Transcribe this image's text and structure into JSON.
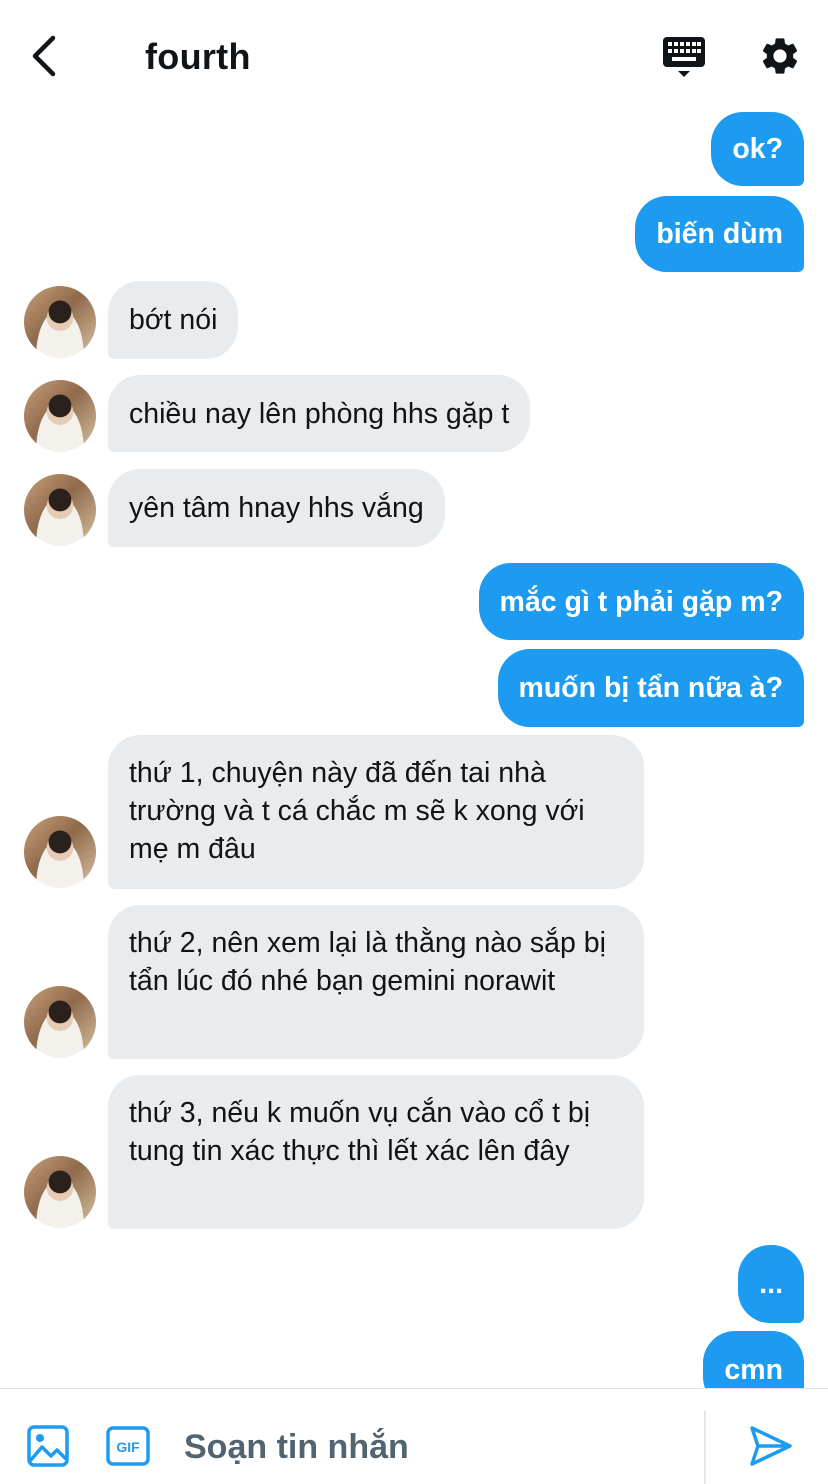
{
  "header": {
    "title": "fourth",
    "icons": {
      "back": "back-arrow-icon",
      "keyboard": "keyboard-icon",
      "settings": "gear-icon"
    }
  },
  "colors": {
    "accent": "#1d9bf0",
    "incoming_bubble": "#e8ecef",
    "text": "#0f1419",
    "muted": "#536471"
  },
  "messages": [
    {
      "dir": "out",
      "text": "ok?"
    },
    {
      "dir": "out",
      "text": "biến dùm"
    },
    {
      "dir": "in",
      "text": "bớt nói"
    },
    {
      "dir": "in",
      "text": "chiều nay lên phòng hhs gặp t"
    },
    {
      "dir": "in",
      "text": "yên tâm hnay hhs vắng"
    },
    {
      "dir": "out",
      "text": "mắc gì t phải gặp m?"
    },
    {
      "dir": "out",
      "text": "muốn bị tẩn nữa à?"
    },
    {
      "dir": "in",
      "text": "thứ 1, chuyện này đã đến tai nhà trường và t cá chắc m sẽ k xong với mẹ m đâu"
    },
    {
      "dir": "in",
      "text": "thứ 2, nên xem lại là thằng nào sắp bị tẩn lúc đó nhé bạn gemini norawit"
    },
    {
      "dir": "in",
      "text": "thứ 3, nếu k muốn vụ cắn vào cổ t bị tung tin xác thực thì lết xác lên đây"
    },
    {
      "dir": "out",
      "text": "..."
    },
    {
      "dir": "out",
      "text": "cmn"
    }
  ],
  "composer": {
    "placeholder": "Soạn tin nhắn",
    "icons": {
      "image": "image-icon",
      "gif": "gif-icon",
      "send": "send-icon"
    },
    "gif_label": "GIF"
  }
}
